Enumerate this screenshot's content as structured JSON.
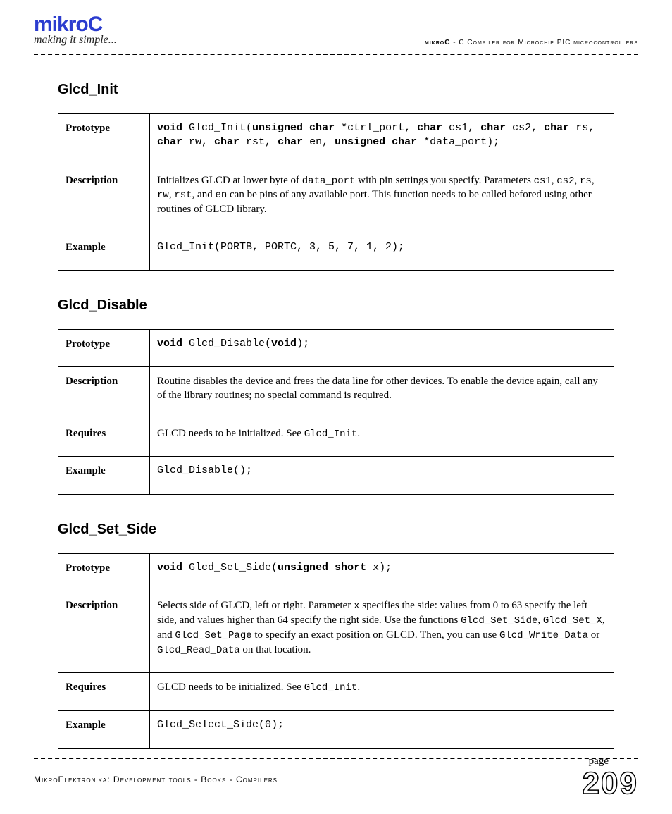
{
  "header": {
    "logo": "mikroC",
    "tagline": "making it simple...",
    "right_brand": "mikroC",
    "right_text": " - C Compiler for Microchip PIC microcontrollers"
  },
  "sections": [
    {
      "title": "Glcd_Init",
      "rows": {
        "prototype_label": "Prototype",
        "description_label": "Description",
        "example_label": "Example",
        "proto": {
          "p1": "void",
          "p2": " Glcd_Init(",
          "p3": "unsigned char",
          "p4": " *ctrl_port, ",
          "p5": "char",
          "p6": " cs1, ",
          "p7": "char",
          "p8": " cs2, ",
          "p9": "char",
          "p10": " rs, ",
          "p11": "char",
          "p12": " rw, ",
          "p13": "char",
          "p14": " rst, ",
          "p15": "char",
          "p16": " en, ",
          "p17": "unsigned char",
          "p18": " *data_port);"
        },
        "desc": {
          "t1": "Initializes GLCD at lower byte of ",
          "c1": "data_port",
          "t2": " with pin settings you specify. Parameters ",
          "c2": "cs1",
          "t3": ", ",
          "c3": "cs2",
          "t4": ", ",
          "c4": "rs",
          "t5": ", ",
          "c5": "rw",
          "t6": ", ",
          "c6": "rst",
          "t7": ", and ",
          "c7": "en",
          "t8": " can be pins of any available port. This function needs to be called befored using other routines of GLCD library."
        },
        "example": "Glcd_Init(PORTB, PORTC, 3, 5, 7, 1, 2);"
      }
    },
    {
      "title": "Glcd_Disable",
      "rows": {
        "prototype_label": "Prototype",
        "description_label": "Description",
        "requires_label": "Requires",
        "example_label": "Example",
        "proto": {
          "p1": "void",
          "p2": " Glcd_Disable(",
          "p3": "void",
          "p4": ");"
        },
        "desc": "Routine disables the device and frees the data line for other devices. To enable the device again, call any of the library routines; no special command is required.",
        "req": {
          "t1": "GLCD needs to be initialized. See ",
          "c1": "Glcd_Init",
          "t2": "."
        },
        "example": "Glcd_Disable();"
      }
    },
    {
      "title": "Glcd_Set_Side",
      "rows": {
        "prototype_label": "Prototype",
        "description_label": "Description",
        "requires_label": "Requires",
        "example_label": "Example",
        "proto": {
          "p1": "void",
          "p2": " Glcd_Set_Side(",
          "p3": "unsigned short",
          "p4": " x);"
        },
        "desc": {
          "t1": "Selects side of GLCD, left or right. Parameter ",
          "c1": "x",
          "t2": " specifies the side: values from 0 to 63 specify the left side, and values higher than 64 specify the right side. Use the functions ",
          "c2": "Glcd_Set_Side",
          "t3": ", ",
          "c3": "Glcd_Set_X",
          "t4": ", and ",
          "c4": "Glcd_Set_Page",
          "t5": " to specify an exact position on GLCD. Then, you can use ",
          "c5": "Glcd_Write_Data",
          "t6": " or ",
          "c6": "Glcd_Read_Data",
          "t7": " on that location."
        },
        "req": {
          "t1": "GLCD needs to be initialized. See ",
          "c1": "Glcd_Init",
          "t2": "."
        },
        "example": "Glcd_Select_Side(0);"
      }
    }
  ],
  "footer": {
    "left": "MikroElektronika: Development tools - Books - Compilers",
    "page_label": "page",
    "page_number": "209"
  }
}
